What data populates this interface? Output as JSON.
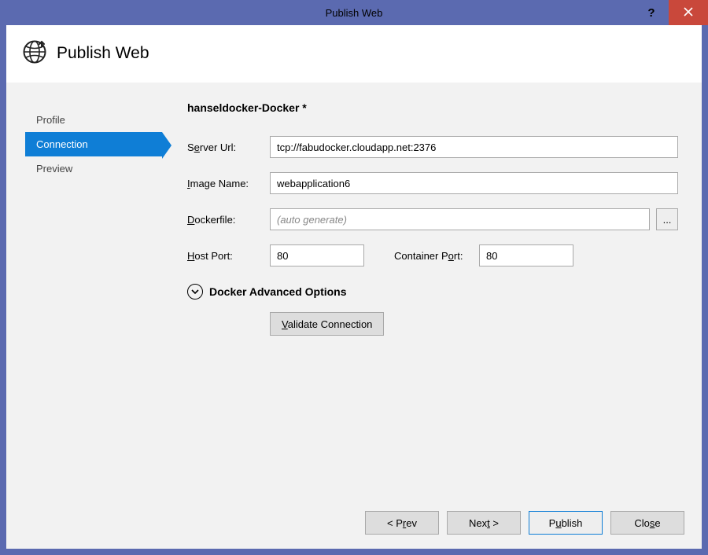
{
  "window": {
    "title": "Publish Web"
  },
  "header": {
    "title": "Publish Web"
  },
  "sidebar": {
    "items": [
      {
        "label": "Profile",
        "selected": false
      },
      {
        "label": "Connection",
        "selected": true
      },
      {
        "label": "Preview",
        "selected": false
      }
    ]
  },
  "main": {
    "profile_name": "hanseldocker-Docker *",
    "server_url": {
      "label_pre": "S",
      "label_ul": "e",
      "label_post": "rver Url:",
      "value": "tcp://fabudocker.cloudapp.net:2376"
    },
    "image_name": {
      "label_ul": "I",
      "label_post": "mage Name:",
      "value": "webapplication6"
    },
    "dockerfile": {
      "label_ul": "D",
      "label_post": "ockerfile:",
      "value": "",
      "placeholder": "(auto generate)",
      "browse": "..."
    },
    "host_port": {
      "label_ul": "H",
      "label_post": "ost Port:",
      "value": "80"
    },
    "container_port": {
      "label_pre": "Container P",
      "label_ul": "o",
      "label_post": "rt:",
      "value": "80"
    },
    "expander_label": "Docker Advanced Options",
    "validate": {
      "label_ul": "V",
      "label_post": "alidate Connection"
    }
  },
  "footer": {
    "prev": {
      "pre": "< P",
      "ul": "r",
      "post": "ev"
    },
    "next": {
      "pre": "Nex",
      "ul": "t",
      "post": " >"
    },
    "publish": {
      "pre": "P",
      "ul": "u",
      "post": "blish"
    },
    "close": {
      "pre": "Clo",
      "ul": "s",
      "post": "e"
    }
  }
}
